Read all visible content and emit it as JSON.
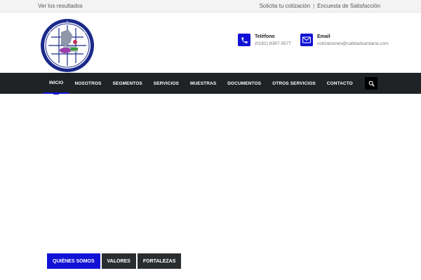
{
  "topbar": {
    "left_link": "Ver los resultados",
    "right_links": [
      "Solicita tu cotización",
      "Encuesta de Satisfacción"
    ],
    "separator": "|"
  },
  "header": {
    "logo_icon": "organization-seal-logo",
    "contacts": {
      "phone": {
        "label": "Teléfono",
        "value": "(0181) 8397-3577",
        "icon": "phone-icon"
      },
      "email": {
        "label": "Email",
        "value": "cotizaciones@calidadsanitaria.com",
        "icon": "envelope-icon"
      }
    }
  },
  "nav": {
    "items": [
      {
        "label": "INICIO",
        "active": true
      },
      {
        "label": "NOSOTROS"
      },
      {
        "label": "SEGMENTOS"
      },
      {
        "label": "SERVICIOS"
      },
      {
        "label": "MUESTRAS"
      },
      {
        "label": "DOCUMENTOS"
      },
      {
        "label": "OTROS SERVICIOS"
      },
      {
        "label": "CONTACTO"
      }
    ],
    "search_icon": "search-icon"
  },
  "tabs": {
    "items": [
      {
        "label": "QUIÉNES SOMOS",
        "active": true
      },
      {
        "label": "VALORES"
      },
      {
        "label": "FORTALEZAS"
      }
    ]
  },
  "colors": {
    "accent": "#1212d6",
    "nav_bg": "#1f2326",
    "topbar_bg": "#f3f3f3"
  }
}
